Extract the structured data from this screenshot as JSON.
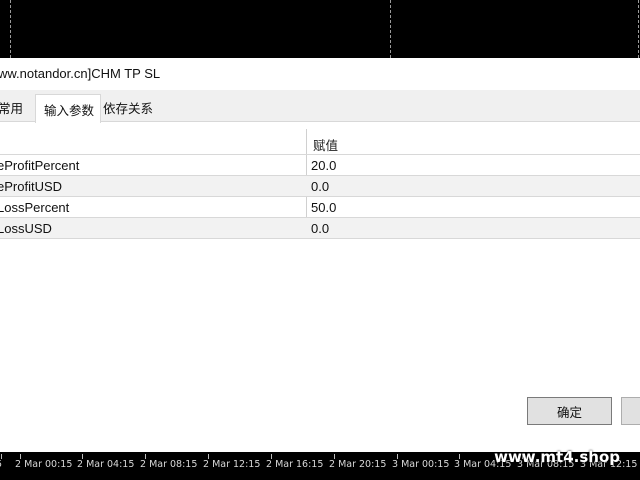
{
  "dialog": {
    "title": "ww.notandor.cn]CHM TP SL",
    "tabs": [
      {
        "label": "常用",
        "active": false
      },
      {
        "label": "输入参数",
        "active": true
      },
      {
        "label": "依存关系",
        "active": false
      }
    ],
    "table": {
      "value_header": "赋值",
      "rows": [
        {
          "name": "eProfitPercent",
          "value": "20.0"
        },
        {
          "name": "eProfitUSD",
          "value": "0.0"
        },
        {
          "name": "LossPercent",
          "value": "50.0"
        },
        {
          "name": "LossUSD",
          "value": "0.0"
        }
      ]
    },
    "buttons": {
      "ok_label": "确定",
      "cancel_label": ""
    }
  },
  "chart": {
    "time_axis": [
      "5",
      "2 Mar 00:15",
      "2 Mar 04:15",
      "2 Mar 08:15",
      "2 Mar 12:15",
      "2 Mar 16:15",
      "2 Mar 20:15",
      "3 Mar 00:15",
      "3 Mar 04:15",
      "3 Mar 08:15",
      "3 Mar 12:15"
    ]
  },
  "watermark": "www.mt4.shop"
}
